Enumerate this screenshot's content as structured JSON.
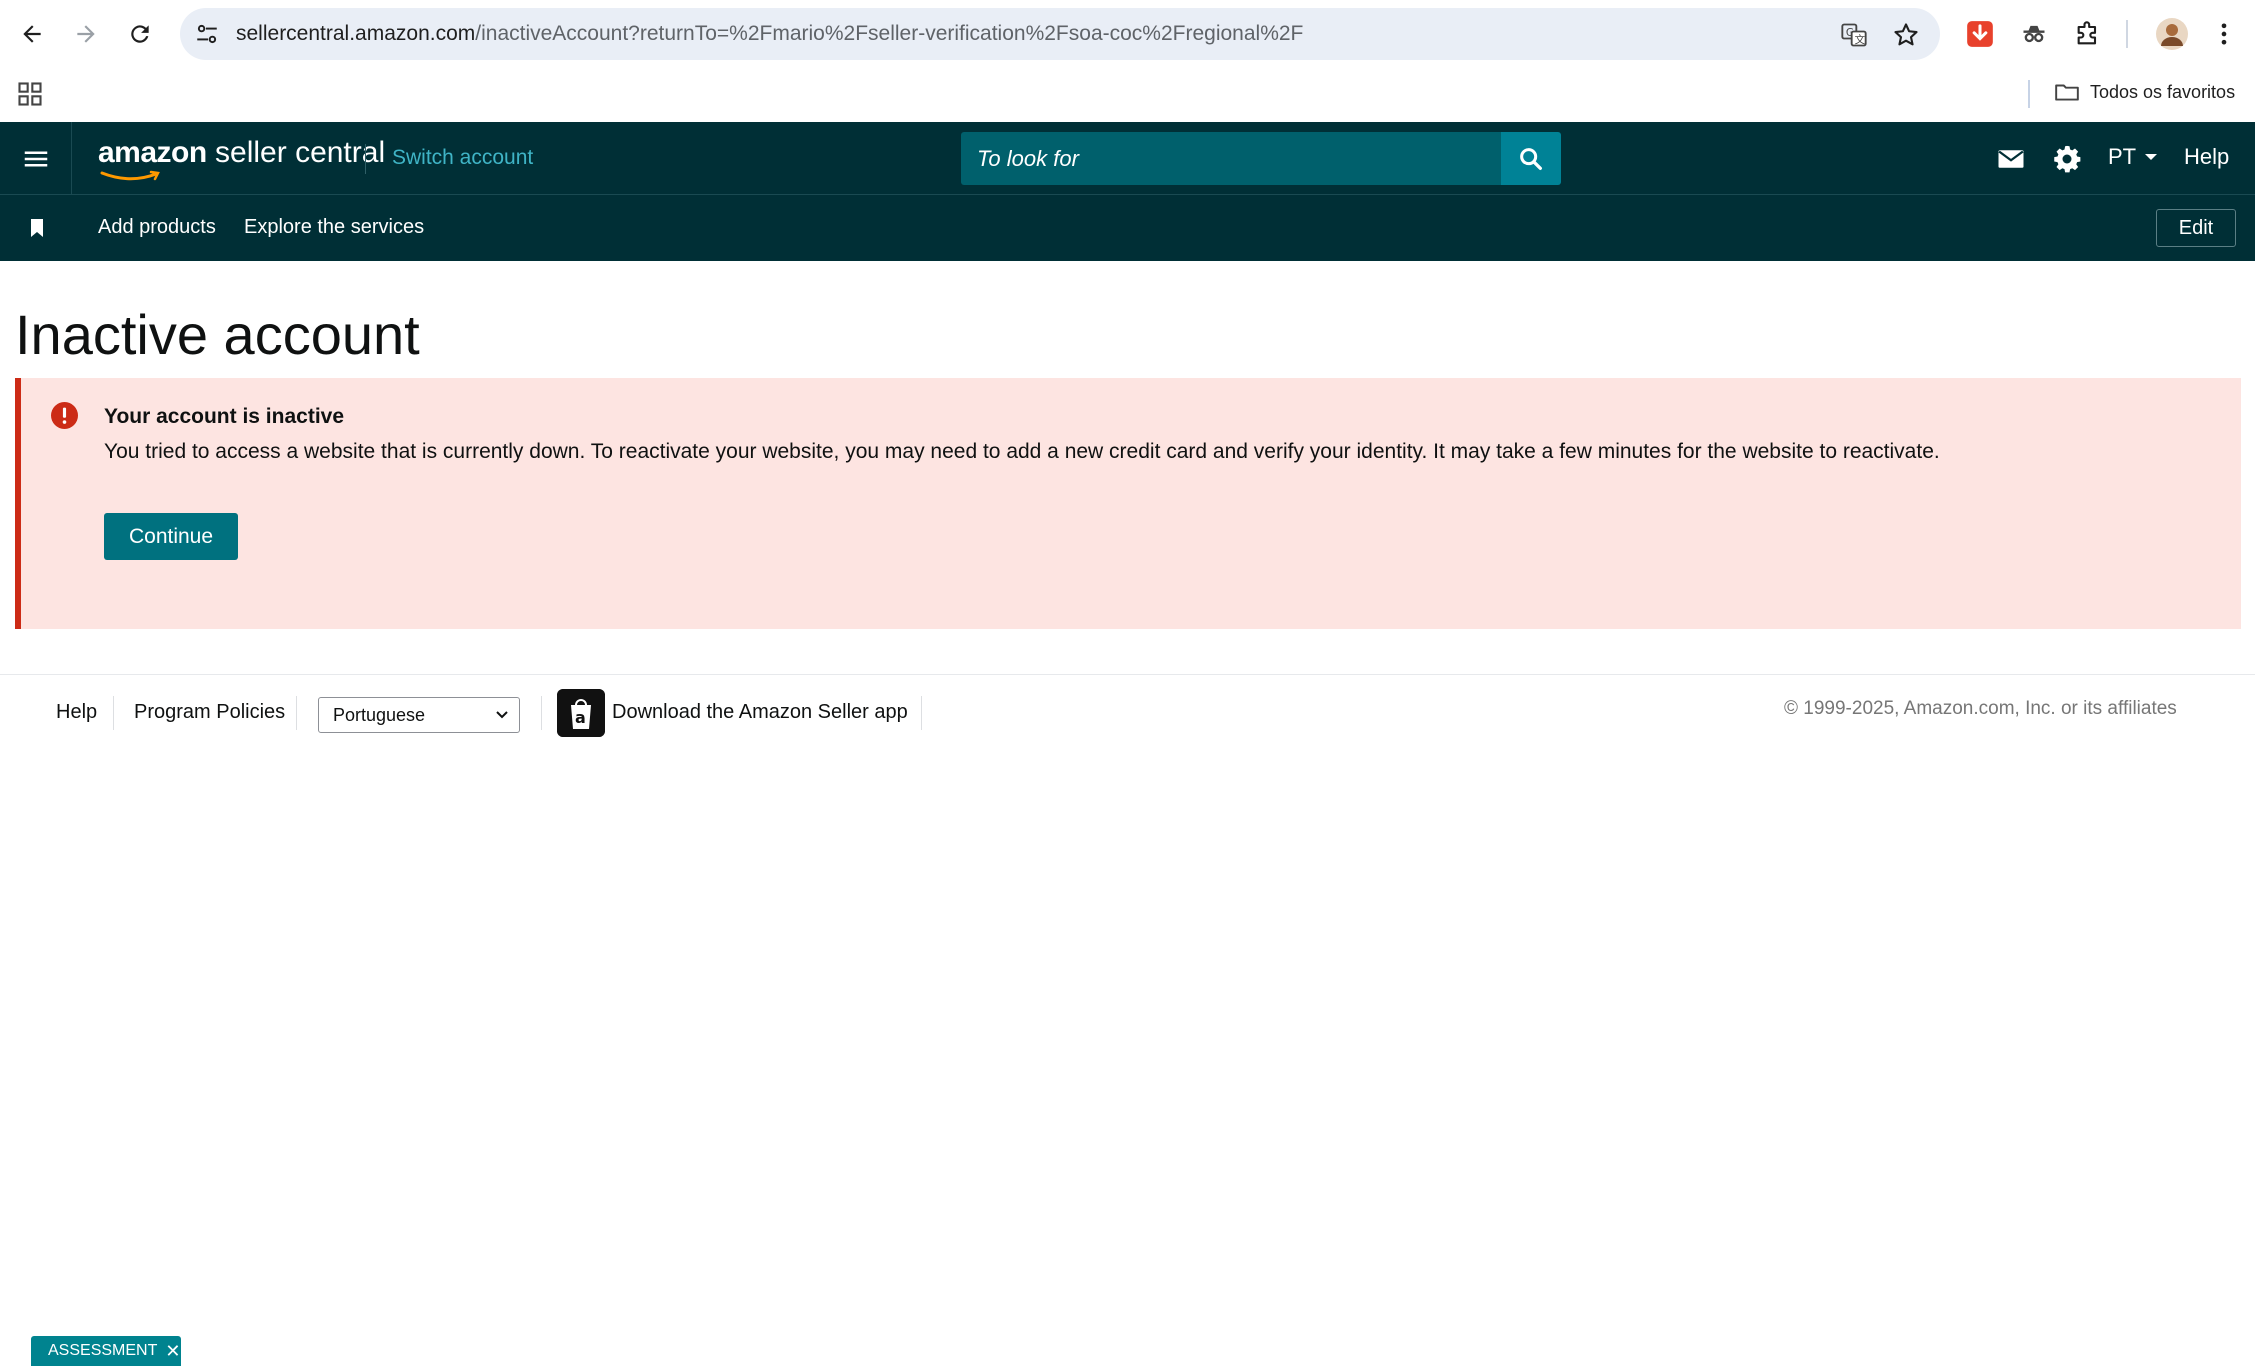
{
  "browser": {
    "url_host": "sellercentral.amazon.com",
    "url_path": "/inactiveAccount?returnTo=%2Fmario%2Fseller-verification%2Fsoa-coc%2Fregional%2F",
    "bookmarks_folder": "Todos os favoritos"
  },
  "header": {
    "logo_brand": "amazon",
    "logo_rest": " seller central",
    "switch_account": "Switch account",
    "search_placeholder": "To look for",
    "language": "PT",
    "help": "Help"
  },
  "subnav": {
    "add_products": "Add products",
    "explore_services": "Explore the services",
    "edit": "Edit"
  },
  "main": {
    "title": "Inactive account",
    "alert": {
      "title": "Your account is inactive",
      "text": "You tried to access a website that is currently down. To reactivate your website, you may need to add a new credit card and verify your identity. It may take a few minutes for the website to reactivate.",
      "button": "Continue"
    }
  },
  "footer": {
    "help": "Help",
    "program_policies": "Program Policies",
    "language_selected": "Portuguese",
    "app_link": "Download the Amazon Seller app",
    "copyright": "© 1999-2025, Amazon.com, Inc. or its affiliates"
  },
  "assessment_tag": "ASSESSMENT",
  "colors": {
    "header_bg": "#002f36",
    "search_bg": "#00606c",
    "search_btn": "#008296",
    "accent_teal": "#00717f",
    "alert_bg": "#fde4e1",
    "alert_border": "#cc2b16"
  }
}
